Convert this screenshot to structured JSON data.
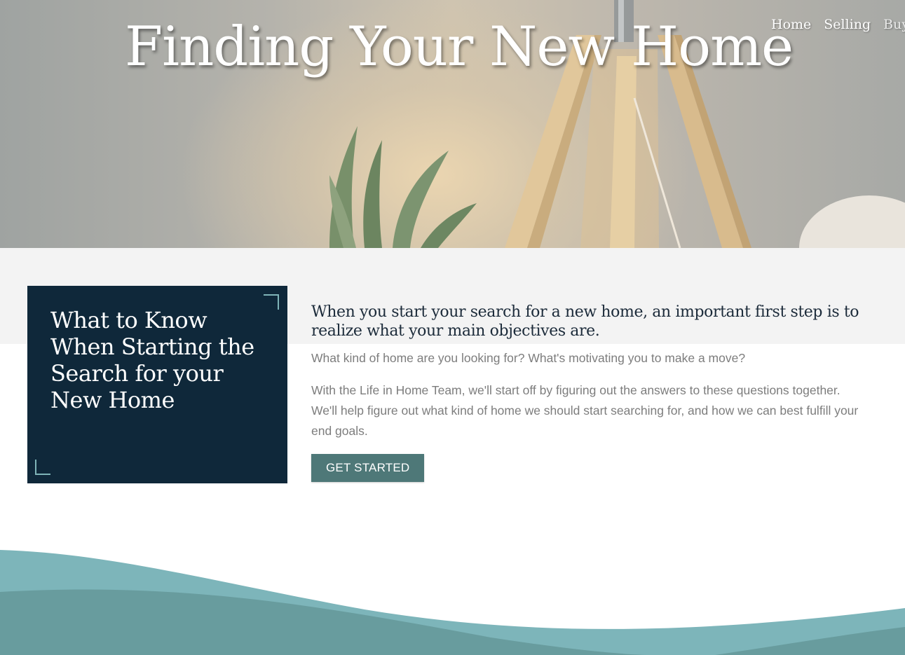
{
  "hero": {
    "title": "Finding Your New Home"
  },
  "nav": {
    "items": [
      "Home",
      "Selling",
      "Buyi"
    ]
  },
  "card": {
    "title": "What to Know When Starting the Search for your New Home"
  },
  "content": {
    "heading": "When you start your search for a new home, an important first step is to realize what your main objectives are.",
    "paragraph1": "What kind of home are you looking for? What's motivating you to make a move?",
    "paragraph2": "With the Life in Home Team, we'll start off by figuring out the answers to these questions together. We'll help figure out what kind of home we should start searching for, and how we can best fulfill your end goals.",
    "cta_label": "GET STARTED"
  },
  "colors": {
    "card_bg": "#0f283a",
    "button_bg": "#4e7878",
    "wave_light": "#7db5ba",
    "wave_dark": "#689c9e",
    "accent": "#7fb4b8"
  }
}
